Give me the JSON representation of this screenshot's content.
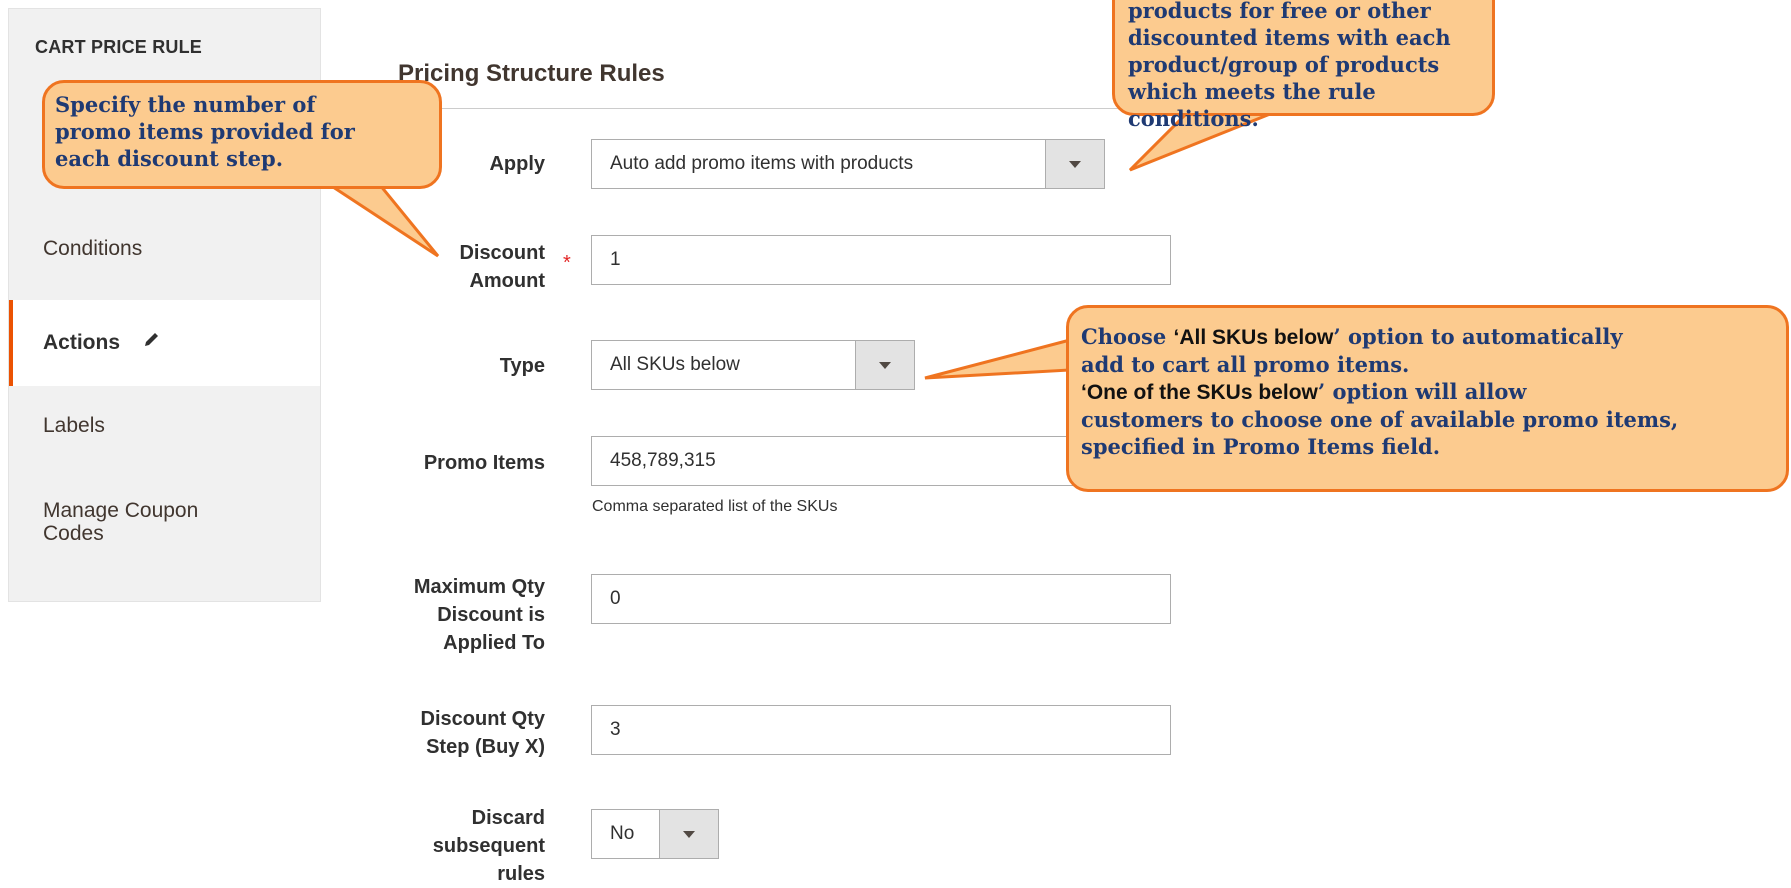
{
  "sidebar": {
    "title": "CART PRICE RULE",
    "items": [
      {
        "label": "Conditions",
        "active": false
      },
      {
        "label": "Actions",
        "active": true
      },
      {
        "label": "Labels",
        "active": false
      },
      {
        "label": "Manage Coupon Codes",
        "active": false
      }
    ]
  },
  "section": {
    "title": "Pricing Structure Rules"
  },
  "form": {
    "apply": {
      "label": "Apply",
      "value": "Auto add promo items with products"
    },
    "discount_amount": {
      "label": "Discount Amount",
      "value": "1",
      "required": "*"
    },
    "type": {
      "label": "Type",
      "value": "All SKUs below"
    },
    "promo_items": {
      "label": "Promo Items",
      "value": "458,789,315",
      "note": "Comma separated list of the SKUs"
    },
    "max_qty": {
      "label": "Maximum Qty Discount is Applied To",
      "value": "0"
    },
    "discount_step": {
      "label": "Discount Qty Step (Buy X)",
      "value": "3"
    },
    "discard": {
      "label": "Discard subsequent rules",
      "value": "No"
    }
  },
  "callouts": {
    "apply": {
      "line1": "products for free or other",
      "line2": "discounted items with each",
      "line3": "product/group of products",
      "line4": "which meets the rule conditions."
    },
    "discount": {
      "line1": "Specify the number of",
      "line2": "promo items provided for",
      "line3": "each discount step."
    },
    "type": {
      "bold1": "‘All SKUs below",
      "pre1": "Choose ",
      "post1": "’ option to automatically",
      "line2": "add to cart all promo items.",
      "bold3": "‘One of the SKUs below",
      "post3": "’ option will allow",
      "line4": "customers to choose one of available promo items,",
      "line5": "specified in Promo Items field."
    }
  },
  "colors": {
    "accent": "#eb5202",
    "callout_fill": "#fccb8f",
    "callout_border": "#ef7420",
    "callout_text": "#1f3a73"
  }
}
